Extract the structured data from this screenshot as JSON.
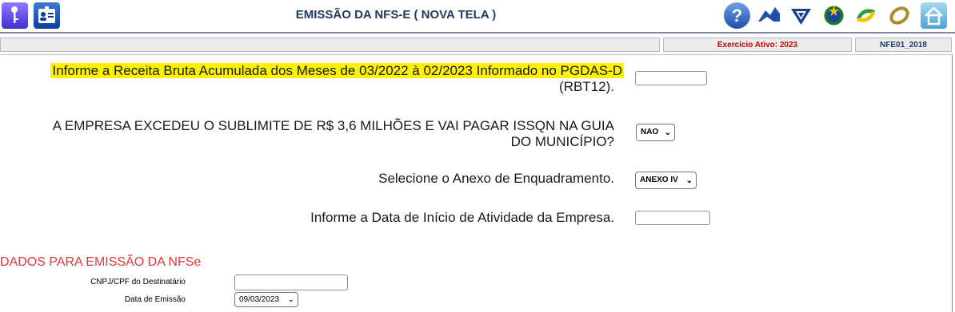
{
  "header": {
    "title": "EMISSÃO DA NFS-E ( NOVA TELA )",
    "left_icons": [
      "key-icon",
      "user-badge-icon"
    ],
    "right_icons": [
      "help-icon",
      "agency-logo-icon",
      "federal-revenue-icon",
      "coat-of-arms-icon",
      "simples-nacional-icon",
      "ring-logo-icon",
      "home-icon"
    ]
  },
  "status": {
    "exercicio": "Exercício Ativo: 2023",
    "code": "NFE01_2018"
  },
  "form": {
    "rbt12_label_line1": "Informe a Receita Bruta Acumulada dos Meses de 03/2022 à 02/2023 Informado no PGDAS-D",
    "rbt12_label_line2": "(RBT12).",
    "rbt12_value": "",
    "sublimite_label_line1": "A EMPRESA EXCEDEU O SUBLIMITE DE R$ 3,6 MILHÕES E VAI PAGAR ISSQN NA GUIA",
    "sublimite_label_line2": "DO MUNICÍPIO?",
    "sublimite_value": "NAO",
    "anexo_label": "Selecione o Anexo de Enquadramento.",
    "anexo_value": "ANEXO IV",
    "inicio_label": "Informe a Data de Início de Atividade da Empresa.",
    "inicio_value": ""
  },
  "emissao": {
    "section_title": "DADOS PARA EMISSÃO DA NFSe",
    "cnpj_label": "CNPJ/CPF do Destinatário",
    "cnpj_value": "",
    "data_label": "Data de Emissão",
    "data_value": "09/03/2023"
  },
  "colors": {
    "title": "#1f3b63",
    "highlight": "#fff200",
    "section_title": "#e03a3a",
    "exercicio": "#cc0000",
    "code": "#1f3b63"
  }
}
